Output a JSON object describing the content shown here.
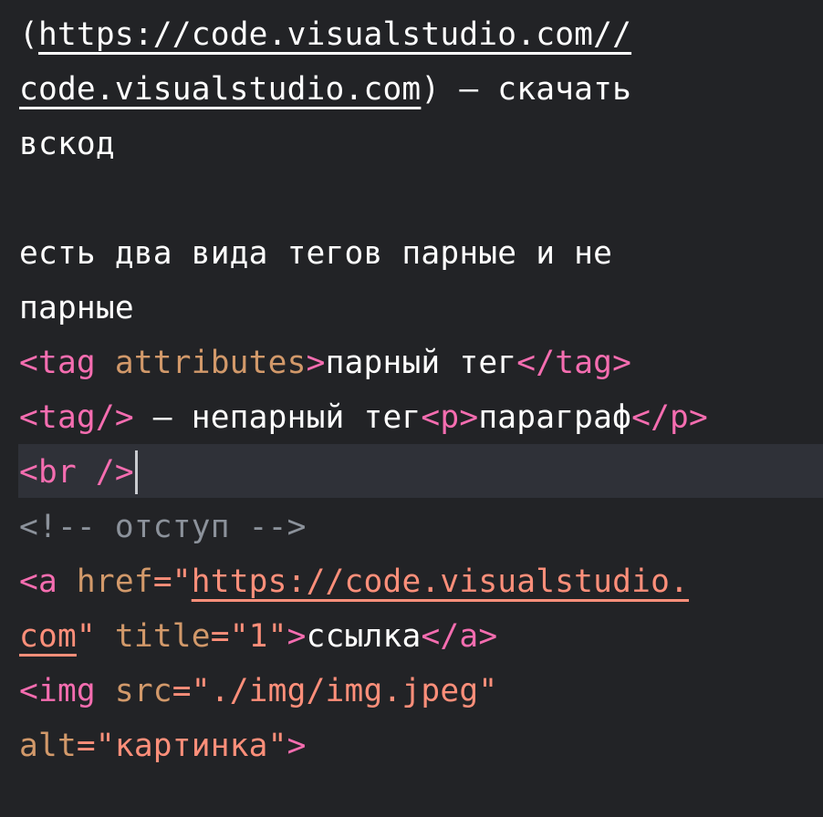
{
  "editor": {
    "lines": [
      {
        "segments": [
          {
            "text": "(",
            "kind": "white"
          },
          {
            "text": "https://code.visualstudio.com//",
            "kind": "white",
            "underline": true
          }
        ]
      },
      {
        "segments": [
          {
            "text": "code.visualstudio.com",
            "kind": "white",
            "underline": true
          },
          {
            "text": ") — скачать",
            "kind": "white"
          }
        ]
      },
      {
        "segments": [
          {
            "text": "вскод",
            "kind": "white"
          }
        ]
      },
      {
        "segments": []
      },
      {
        "segments": [
          {
            "text": "есть два вида тегов парные и не",
            "kind": "white"
          }
        ]
      },
      {
        "segments": [
          {
            "text": "парные",
            "kind": "white"
          }
        ]
      },
      {
        "segments": [
          {
            "text": "<tag ",
            "kind": "tag"
          },
          {
            "text": "attributes",
            "kind": "attr"
          },
          {
            "text": ">",
            "kind": "tag"
          },
          {
            "text": "парный тег",
            "kind": "white"
          },
          {
            "text": "</tag>",
            "kind": "tag"
          }
        ]
      },
      {
        "segments": [
          {
            "text": "<tag/>",
            "kind": "tag"
          },
          {
            "text": " — непарный тег",
            "kind": "white"
          },
          {
            "text": "<p>",
            "kind": "tag"
          },
          {
            "text": "параграф",
            "kind": "white"
          },
          {
            "text": "</p>",
            "kind": "tag"
          }
        ]
      },
      {
        "current": true,
        "segments": [
          {
            "text": "<br />",
            "kind": "tag"
          }
        ]
      },
      {
        "segments": [
          {
            "text": "<!-- отступ -->",
            "kind": "cmt"
          }
        ]
      },
      {
        "segments": [
          {
            "text": "<a ",
            "kind": "tag"
          },
          {
            "text": "href",
            "kind": "attr"
          },
          {
            "text": "=\"",
            "kind": "str"
          },
          {
            "text": "https://code.visualstudio.",
            "kind": "str",
            "underline": true
          }
        ]
      },
      {
        "segments": [
          {
            "text": "com",
            "kind": "str",
            "underline": true
          },
          {
            "text": "\" ",
            "kind": "str"
          },
          {
            "text": "title",
            "kind": "attr"
          },
          {
            "text": "=\"1\"",
            "kind": "str"
          },
          {
            "text": ">",
            "kind": "tag"
          },
          {
            "text": "ссылка",
            "kind": "white"
          },
          {
            "text": "</a>",
            "kind": "tag"
          }
        ]
      },
      {
        "segments": [
          {
            "text": "<img ",
            "kind": "tag"
          },
          {
            "text": "src",
            "kind": "attr"
          },
          {
            "text": "=\"./img/img.jpeg\"",
            "kind": "str"
          }
        ]
      },
      {
        "segments": [
          {
            "text": "alt",
            "kind": "attr"
          },
          {
            "text": "=\"картинка\"",
            "kind": "str"
          },
          {
            "text": ">",
            "kind": "tag"
          }
        ]
      }
    ]
  },
  "colors": {
    "background": "#222326",
    "current_line": "#2f3138",
    "text": "#ffffff",
    "tag": "#f56db0",
    "attribute": "#d2996a",
    "string": "#ff8f7a",
    "comment": "#8c929b"
  }
}
